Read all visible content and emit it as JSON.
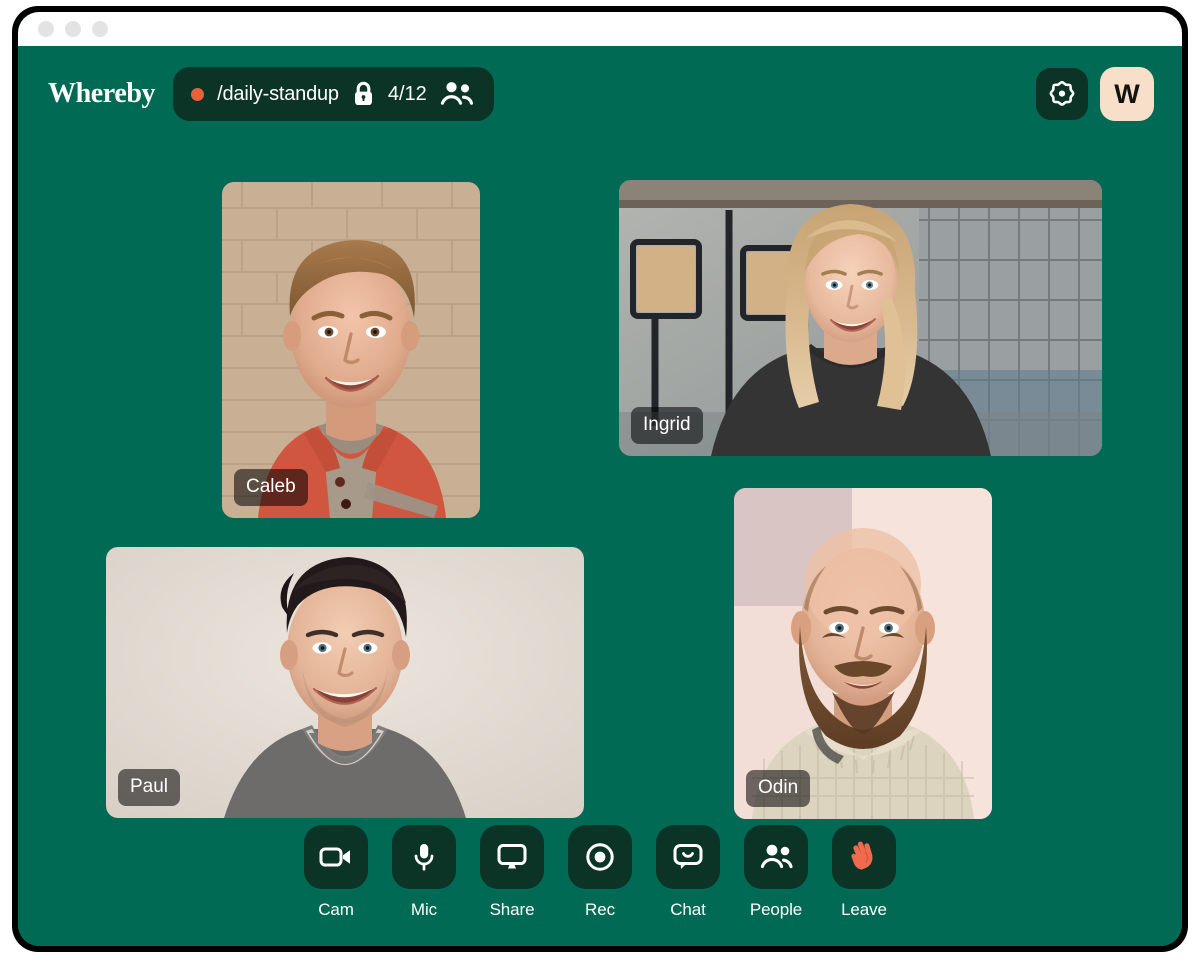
{
  "window": {
    "traffic_lights": [
      "close",
      "minimize",
      "maximize"
    ]
  },
  "header": {
    "brand": "Whereby",
    "recording_indicator": "recording-dot",
    "room_name": "/daily-standup",
    "lock_icon": "lock-icon",
    "participant_count": "4/12",
    "people_icon": "people-icon",
    "settings_icon": "gear-icon",
    "avatar_initial": "W"
  },
  "participants": [
    {
      "id": "caleb",
      "name": "Caleb",
      "layout": "portrait",
      "scene": "brick-wall-red-polo"
    },
    {
      "id": "ingrid",
      "name": "Ingrid",
      "layout": "landscape",
      "scene": "office-blonde-dark-sweater"
    },
    {
      "id": "paul",
      "name": "Paul",
      "layout": "landscape",
      "scene": "plain-wall-grey-vneck"
    },
    {
      "id": "odin",
      "name": "Odin",
      "layout": "portrait",
      "scene": "pink-wall-beard-knit-sweater"
    }
  ],
  "toolbar": [
    {
      "id": "cam",
      "label": "Cam",
      "icon": "video-camera-icon"
    },
    {
      "id": "mic",
      "label": "Mic",
      "icon": "microphone-icon"
    },
    {
      "id": "share",
      "label": "Share",
      "icon": "screen-share-icon"
    },
    {
      "id": "rec",
      "label": "Rec",
      "icon": "record-icon"
    },
    {
      "id": "chat",
      "label": "Chat",
      "icon": "chat-bubble-icon"
    },
    {
      "id": "people",
      "label": "People",
      "icon": "people-icon"
    },
    {
      "id": "leave",
      "label": "Leave",
      "icon": "waving-hand-icon"
    }
  ],
  "colors": {
    "brand_green": "#006a55",
    "dark_green": "#0b3326",
    "accent_orange": "#e8603c",
    "avatar_cream": "#f7dfc9",
    "text_white": "#ffffff"
  }
}
